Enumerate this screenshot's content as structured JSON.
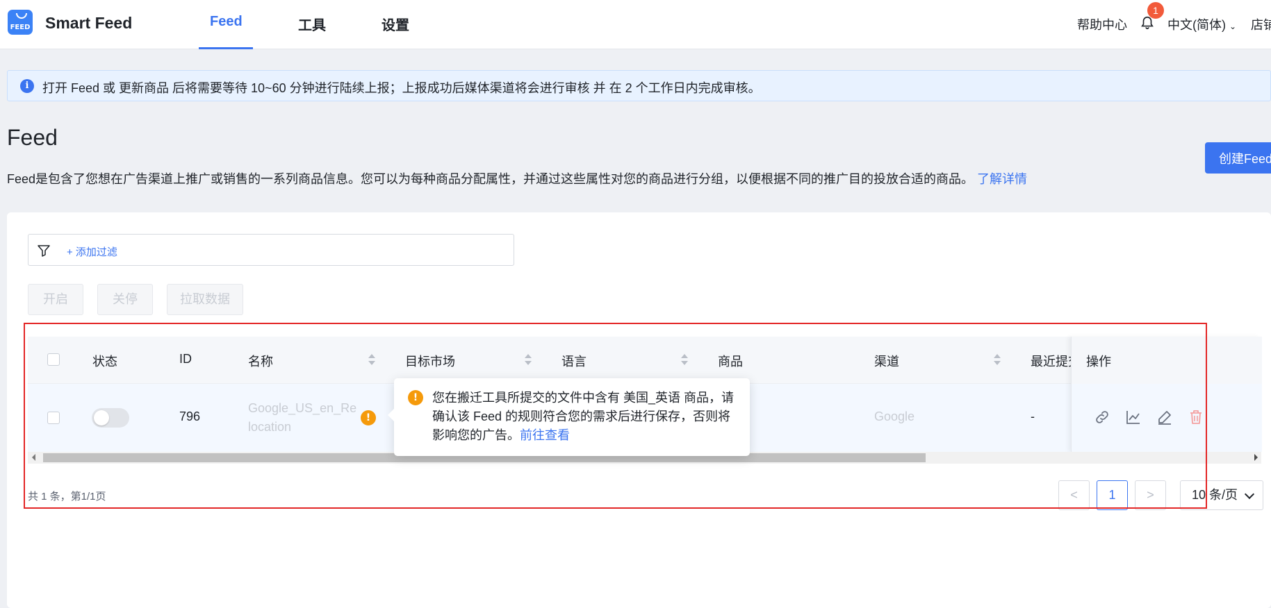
{
  "app": {
    "name": "Smart Feed",
    "logo_text": "FEED"
  },
  "nav": {
    "tabs": [
      {
        "label": "Feed",
        "active": true
      },
      {
        "label": "工具",
        "active": false
      },
      {
        "label": "设置",
        "active": false
      }
    ],
    "help": "帮助中心",
    "notification_count": "1",
    "language": "中文(简体)",
    "store": "店铺"
  },
  "banner": {
    "icon": "i",
    "text": "打开 Feed 或 更新商品 后将需要等待 10~60 分钟进行陆续上报；上报成功后媒体渠道将会进行审核 并 在 2 个工作日内完成审核。"
  },
  "page": {
    "title": "Feed",
    "description": "Feed是包含了您想在广告渠道上推广或销售的一系列商品信息。您可以为每种商品分配属性，并通过这些属性对您的商品进行分组，以便根据不同的推广目的投放合适的商品。",
    "learn_more": "了解详情",
    "create_button": "创建Feed"
  },
  "filter": {
    "add_label": "+ 添加过滤"
  },
  "actions": {
    "enable": "开启",
    "disable": "关停",
    "fetch": "拉取数据"
  },
  "table": {
    "columns": {
      "status": "状态",
      "id": "ID",
      "name": "名称",
      "market": "目标市场",
      "language": "语言",
      "products": "商品",
      "channel": "渠道",
      "last_submit": "最近提交",
      "operations": "操作"
    },
    "rows": [
      {
        "enabled": false,
        "id": "796",
        "name": "Google_US_en_Relocation",
        "channel": "Google",
        "last_submit": "-"
      }
    ]
  },
  "tooltip": {
    "text": "您在搬迁工具所提交的文件中含有 美国_英语 商品，请确认该 Feed 的规则符合您的需求后进行保存，否则将影响您的广告。",
    "link": "前往查看"
  },
  "pagination": {
    "total": "共 1 条，第1/1页",
    "prev": "<",
    "current": "1",
    "next": ">",
    "page_size": "10 条/页"
  },
  "colors": {
    "primary": "#3b74f0",
    "warning": "#f59a0b",
    "danger": "#f25a3a",
    "annotation": "#e32626"
  }
}
